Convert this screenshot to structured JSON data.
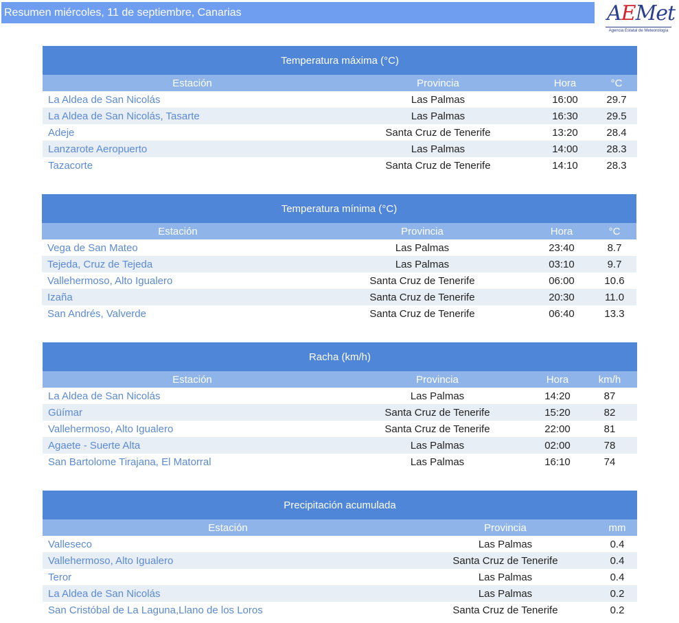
{
  "header": {
    "title": "Resumen miércoles, 11 de septiembre, Canarias"
  },
  "logo": {
    "text_a": "A",
    "text_e": "E",
    "text_met": "Met",
    "subtitle": "Agencia Estatal de Meteorología"
  },
  "tmax": {
    "title": "Temperatura máxima (°C)",
    "columns": [
      "Estación",
      "Provincia",
      "Hora",
      "°C"
    ],
    "rows": [
      [
        "La Aldea de San Nicolás",
        "Las Palmas",
        "16:00",
        "29.7"
      ],
      [
        "La Aldea de San Nicolás, Tasarte",
        "Las Palmas",
        "16:30",
        "29.5"
      ],
      [
        "Adeje",
        "Santa Cruz de Tenerife",
        "13:20",
        "28.4"
      ],
      [
        "Lanzarote Aeropuerto",
        "Las Palmas",
        "14:00",
        "28.3"
      ],
      [
        "Tazacorte",
        "Santa Cruz de Tenerife",
        "14:10",
        "28.3"
      ]
    ]
  },
  "tmin": {
    "title": "Temperatura mínima (°C)",
    "columns": [
      "Estación",
      "Provincia",
      "Hora",
      "°C"
    ],
    "rows": [
      [
        "Vega de San Mateo",
        "Las Palmas",
        "23:40",
        "8.7"
      ],
      [
        "Tejeda, Cruz de Tejeda",
        "Las Palmas",
        "03:10",
        "9.7"
      ],
      [
        "Vallehermoso, Alto Igualero",
        "Santa Cruz de Tenerife",
        "06:00",
        "10.6"
      ],
      [
        "Izaña",
        "Santa Cruz de Tenerife",
        "20:30",
        "11.0"
      ],
      [
        "San Andrés, Valverde",
        "Santa Cruz de Tenerife",
        "06:40",
        "13.3"
      ]
    ]
  },
  "racha": {
    "title": "Racha (km/h)",
    "columns": [
      "Estación",
      "Provincia",
      "Hora",
      "km/h"
    ],
    "rows": [
      [
        "La Aldea de San Nicolás",
        "Las Palmas",
        "14:20",
        "87"
      ],
      [
        "Güímar",
        "Santa Cruz de Tenerife",
        "15:20",
        "82"
      ],
      [
        "Vallehermoso, Alto Igualero",
        "Santa Cruz de Tenerife",
        "22:00",
        "81"
      ],
      [
        "Agaete - Suerte Alta",
        "Las Palmas",
        "02:00",
        "78"
      ],
      [
        "San Bartolome Tirajana, El Matorral",
        "Las Palmas",
        "16:10",
        "74"
      ]
    ]
  },
  "precip": {
    "title": "Precipitación acumulada",
    "columns": [
      "Estación",
      "Provincia",
      "mm"
    ],
    "rows": [
      [
        "Valleseco",
        "Las Palmas",
        "0.4"
      ],
      [
        "Vallehermoso, Alto Igualero",
        "Santa Cruz de Tenerife",
        "0.4"
      ],
      [
        "Teror",
        "Las Palmas",
        "0.4"
      ],
      [
        "La Aldea de San Nicolás",
        "Las Palmas",
        "0.2"
      ],
      [
        "San Cristóbal de La Laguna,Llano de los Loros",
        "Santa Cruz de Tenerife",
        "0.2"
      ]
    ]
  }
}
